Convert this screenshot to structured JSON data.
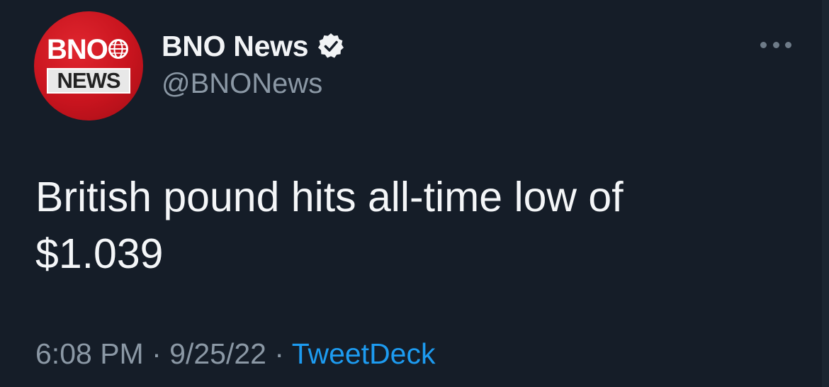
{
  "tweet": {
    "author": {
      "display_name": "BNO News",
      "handle": "@BNONews",
      "verified": true,
      "avatar": {
        "line1": "BNO",
        "line2": "NEWS",
        "icon": "globe-icon"
      }
    },
    "menu_icon": "more-options-icon",
    "text_line1": "British pound hits all-time low of",
    "text_line2": "$1.039",
    "time": "6:08 PM",
    "separator": "·",
    "date": "9/25/22",
    "source": "TweetDeck"
  },
  "colors": {
    "background": "#151d28",
    "primary_text": "#f4f6f8",
    "secondary_text": "#8b98a5",
    "accent": "#1d9bf0",
    "avatar_red": "#c8141e"
  }
}
